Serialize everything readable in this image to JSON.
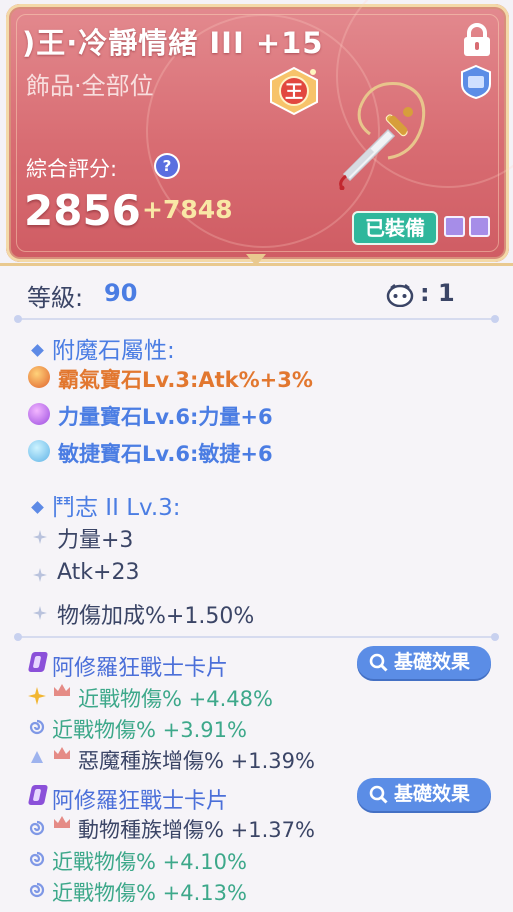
{
  "item": {
    "name": ")王·冷靜情緒 III +15",
    "slot": "飾品·全部位",
    "score_label": "綜合評分:",
    "score": "2856",
    "score_bonus": "+7848",
    "equipped_label": "已裝備"
  },
  "level": {
    "label": "等級:",
    "value": "90",
    "pet_value": ": 1"
  },
  "enchant": {
    "title": "附魔石屬性:",
    "gems": [
      {
        "text": "霸氣寶石Lv.3:Atk%+3%",
        "color": "#e2772f"
      },
      {
        "text": "力量寶石Lv.6:力量+6",
        "color": "#4b7de3"
      },
      {
        "text": "敏捷寶石Lv.6:敏捷+6",
        "color": "#4b7de3"
      }
    ]
  },
  "spirit": {
    "title": "鬥志 II Lv.3:",
    "stats": [
      "力量+3",
      "Atk+23",
      "物傷加成%+1.50%"
    ]
  },
  "cards": [
    {
      "title": "阿修羅狂戰士卡片",
      "button": "基礎效果",
      "effects": [
        "近戰物傷% +4.48%",
        "近戰物傷% +3.91%",
        "惡魔種族增傷% +1.39%"
      ]
    },
    {
      "title": "阿修羅狂戰士卡片",
      "button": "基礎效果",
      "effects": [
        "動物種族增傷% +1.37%",
        "近戰物傷% +4.10%",
        "近戰物傷% +4.13%"
      ]
    }
  ],
  "icons": {
    "lock": "lock-icon",
    "shield": "shield-icon",
    "king": "king-badge-icon",
    "weapon": "dagger-necklace-icon",
    "help": "help-icon",
    "pet": "pet-icon"
  },
  "colors": {
    "accent": "#4b7de3",
    "header": "#d86c72",
    "equipped": "#2fb79c",
    "effect_green": "#3da88a"
  }
}
